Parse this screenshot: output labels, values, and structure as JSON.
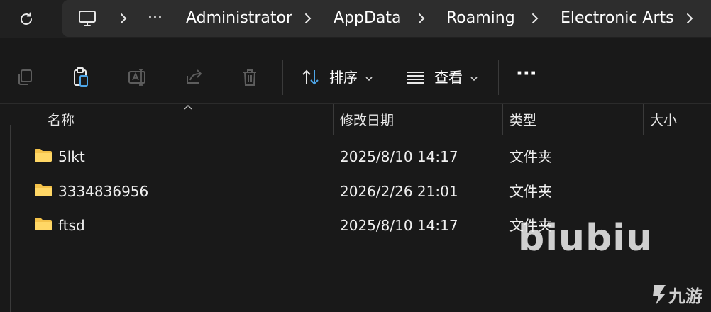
{
  "address_bar": {
    "overflow_label": "···",
    "breadcrumbs": [
      "Administrator",
      "AppData",
      "Roaming",
      "Electronic Arts"
    ]
  },
  "toolbar": {
    "sort_label": "排序",
    "view_label": "查看",
    "more_label": "···"
  },
  "columns": {
    "name": "名称",
    "modified": "修改日期",
    "type": "类型",
    "size": "大小"
  },
  "rows": [
    {
      "name": "5lkt",
      "modified": "2025/8/10 14:17",
      "type": "文件夹"
    },
    {
      "name": "3334836956",
      "modified": "2026/2/26 21:01",
      "type": "文件夹"
    },
    {
      "name": "ftsd",
      "modified": "2025/8/10 14:17",
      "type": "文件夹"
    }
  ],
  "watermark": {
    "text": "biubiu",
    "logo_text": "九游"
  },
  "colors": {
    "background": "#191919",
    "address_box": "#2d2d2d",
    "folder": "#f4c24a",
    "icon_muted": "#6f6f6f"
  }
}
